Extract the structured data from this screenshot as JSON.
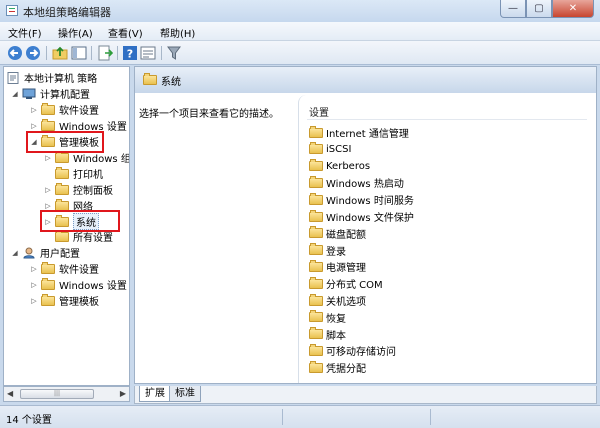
{
  "window": {
    "title": "本地组策略编辑器",
    "minimize": "—",
    "maximize": "▢",
    "close": "✕"
  },
  "menu": [
    "文件(F)",
    "操作(A)",
    "查看(V)",
    "帮助(H)"
  ],
  "toolbar_icons": [
    "back-arrow-icon",
    "forward-arrow-icon",
    "up-folder-icon",
    "show-tree-icon",
    "export-list-icon",
    "help-icon",
    "properties-icon",
    "filter-icon"
  ],
  "tree": {
    "root": "本地计算机 策略",
    "computer_config": "计算机配置",
    "software": "软件设置",
    "windows_settings": "Windows 设置",
    "admin_templates": "管理模板",
    "windows_components": "Windows 组件",
    "printers": "打印机",
    "control_panel": "控制面板",
    "network": "网络",
    "system": "系统",
    "all_settings": "所有设置",
    "user_config": "用户配置",
    "u_software": "软件设置",
    "u_windows_settings": "Windows 设置",
    "u_admin_templates": "管理模板"
  },
  "right": {
    "header": "系统",
    "description": "选择一个项目来查看它的描述。",
    "column": "设置",
    "items": [
      "Internet 通信管理",
      "iSCSI",
      "Kerberos",
      "Windows 热启动",
      "Windows 时间服务",
      "Windows 文件保护",
      "磁盘配额",
      "登录",
      "电源管理",
      "分布式 COM",
      "关机选项",
      "恢复",
      "脚本",
      "可移动存储访问",
      "凭据分配"
    ]
  },
  "tabs": [
    "扩展",
    "标准"
  ],
  "status": "14 个设置",
  "colors": {
    "highlight_box": "#e0171c",
    "header_gradient": "#c7d7ea",
    "folder": "#e9c14f"
  }
}
